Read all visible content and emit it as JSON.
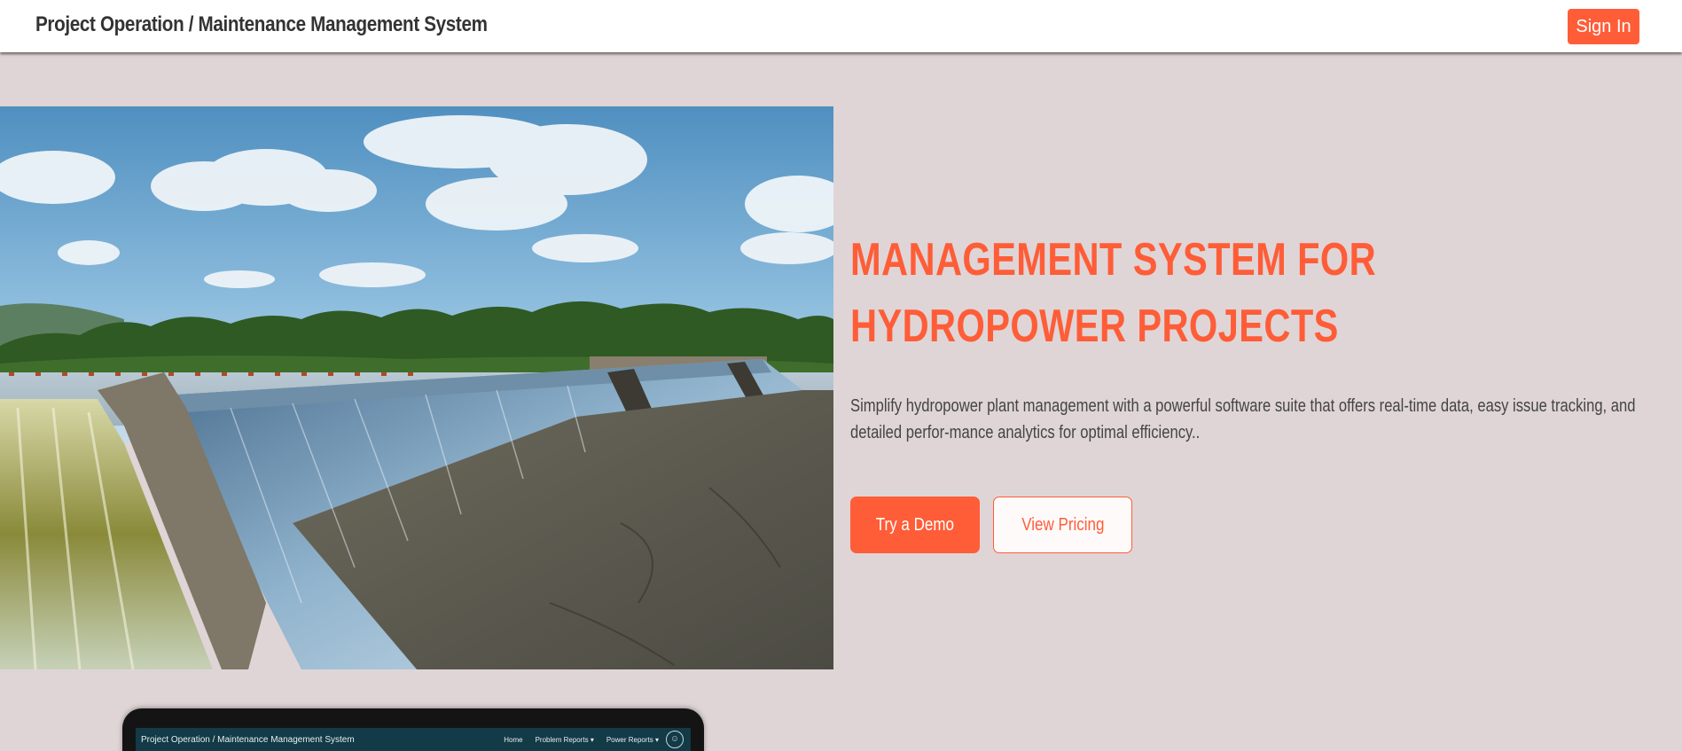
{
  "navbar": {
    "brand": "Project Operation / Maintenance Management System",
    "signin_label": "Sign In"
  },
  "hero": {
    "image_alt": "hydropower-dam-spillway-photo",
    "title_line1": "MANAGEMENT SYSTEM FOR",
    "title_line2": "HYDROPOWER PROJECTS",
    "description": "Simplify hydropower plant management with a powerful software suite that offers real-time data, easy issue tracking, and detailed perfor-mance analytics for optimal efficiency..",
    "demo_label": "Try a Demo",
    "pricing_label": "View Pricing"
  },
  "device_preview": {
    "title": "Project Operation / Maintenance Management System",
    "nav": [
      "Home",
      "Problem Reports ▾",
      "Power Reports ▾"
    ],
    "avatar_icon": "user-avatar-icon"
  },
  "colors": {
    "accent": "#fe5d38",
    "page_background": "#dfd5d6",
    "navbar_background": "#ffffff",
    "text_dark": "#333333"
  }
}
